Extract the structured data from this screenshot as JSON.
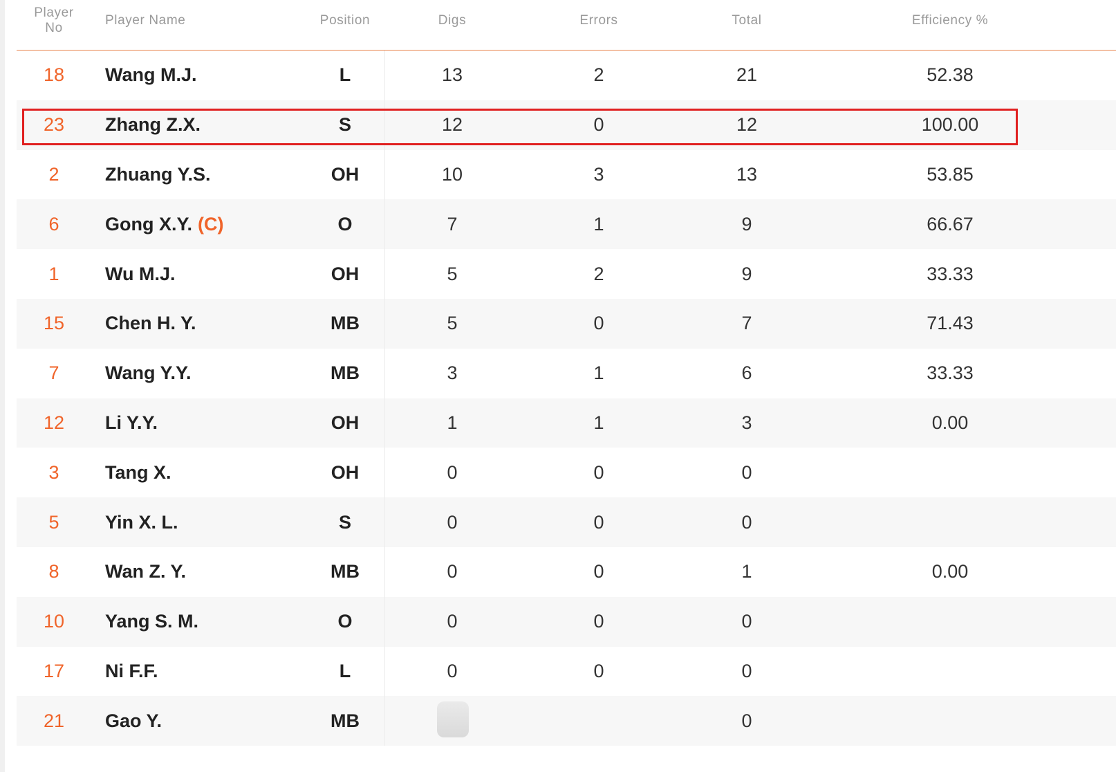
{
  "table": {
    "headers": {
      "no_line1": "Player",
      "no_line2": "No",
      "name": "Player Name",
      "position": "Position",
      "digs": "Digs",
      "errors": "Errors",
      "total": "Total",
      "efficiency": "Efficiency %"
    },
    "rows": [
      {
        "no": "18",
        "name": "Wang M.J.",
        "captain": "",
        "position": "L",
        "digs": "13",
        "errors": "2",
        "total": "21",
        "efficiency": "52.38"
      },
      {
        "no": "23",
        "name": "Zhang Z.X.",
        "captain": "",
        "position": "S",
        "digs": "12",
        "errors": "0",
        "total": "12",
        "efficiency": "100.00"
      },
      {
        "no": "2",
        "name": "Zhuang Y.S.",
        "captain": "",
        "position": "OH",
        "digs": "10",
        "errors": "3",
        "total": "13",
        "efficiency": "53.85"
      },
      {
        "no": "6",
        "name": "Gong X.Y.",
        "captain": "(C)",
        "position": "O",
        "digs": "7",
        "errors": "1",
        "total": "9",
        "efficiency": "66.67"
      },
      {
        "no": "1",
        "name": "Wu M.J.",
        "captain": "",
        "position": "OH",
        "digs": "5",
        "errors": "2",
        "total": "9",
        "efficiency": "33.33"
      },
      {
        "no": "15",
        "name": "Chen H. Y.",
        "captain": "",
        "position": "MB",
        "digs": "5",
        "errors": "0",
        "total": "7",
        "efficiency": "71.43"
      },
      {
        "no": "7",
        "name": "Wang Y.Y.",
        "captain": "",
        "position": "MB",
        "digs": "3",
        "errors": "1",
        "total": "6",
        "efficiency": "33.33"
      },
      {
        "no": "12",
        "name": "Li Y.Y.",
        "captain": "",
        "position": "OH",
        "digs": "1",
        "errors": "1",
        "total": "3",
        "efficiency": "0.00"
      },
      {
        "no": "3",
        "name": "Tang X.",
        "captain": "",
        "position": "OH",
        "digs": "0",
        "errors": "0",
        "total": "0",
        "efficiency": ""
      },
      {
        "no": "5",
        "name": "Yin X. L.",
        "captain": "",
        "position": "S",
        "digs": "0",
        "errors": "0",
        "total": "0",
        "efficiency": ""
      },
      {
        "no": "8",
        "name": "Wan Z. Y.",
        "captain": "",
        "position": "MB",
        "digs": "0",
        "errors": "0",
        "total": "1",
        "efficiency": "0.00"
      },
      {
        "no": "10",
        "name": "Yang S. M.",
        "captain": "",
        "position": "O",
        "digs": "0",
        "errors": "0",
        "total": "0",
        "efficiency": ""
      },
      {
        "no": "17",
        "name": "Ni F.F.",
        "captain": "",
        "position": "L",
        "digs": "0",
        "errors": "0",
        "total": "0",
        "efficiency": ""
      },
      {
        "no": "21",
        "name": "Gao Y.",
        "captain": "",
        "position": "MB",
        "digs": "",
        "errors": "",
        "total": "0",
        "efficiency": ""
      }
    ]
  },
  "highlight": {
    "row_index": 1,
    "color": "#e02020"
  },
  "colors": {
    "accent": "#f0642a",
    "header_rule": "#e8824a",
    "alt_row": "#f7f7f7"
  }
}
